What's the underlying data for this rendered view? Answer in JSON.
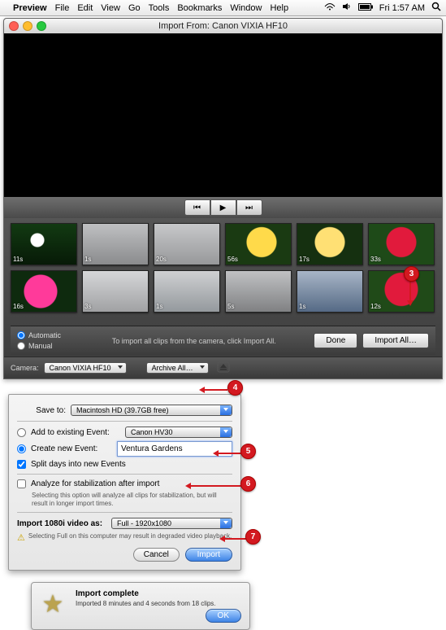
{
  "menu": {
    "items": [
      "Preview",
      "File",
      "Edit",
      "View",
      "Go",
      "Tools",
      "Bookmarks",
      "Window",
      "Help"
    ],
    "clock": "Fri 1:57 AM"
  },
  "window": {
    "title": "Import From: Canon VIXIA HF10"
  },
  "thumbs": [
    {
      "dur": "11s"
    },
    {
      "dur": "1s"
    },
    {
      "dur": "20s"
    },
    {
      "dur": "56s"
    },
    {
      "dur": "17s"
    },
    {
      "dur": "33s"
    },
    {
      "dur": "16s"
    },
    {
      "dur": "3s"
    },
    {
      "dur": "1s"
    },
    {
      "dur": "5s"
    },
    {
      "dur": "1s"
    },
    {
      "dur": "12s"
    }
  ],
  "bottom": {
    "auto_label": "Automatic",
    "manual_label": "Manual",
    "hint": "To import all clips from the camera, click Import All.",
    "done": "Done",
    "import_all": "Import All…"
  },
  "camfooter": {
    "label": "Camera:",
    "camera": "Canon VIXIA HF10",
    "archive": "Archive All…"
  },
  "sheet": {
    "save_to_label": "Save to:",
    "save_to_value": "Macintosh HD (39.7GB free)",
    "add_existing_label": "Add to existing Event:",
    "add_existing_value": "Canon HV30",
    "create_new_label": "Create new Event:",
    "create_new_value": "Ventura Gardens",
    "split_days": "Split days into new Events",
    "analyze": "Analyze for stabilization after import",
    "analyze_hint": "Selecting this option will analyze all clips for stabilization, but will result in longer import times.",
    "import1080_label": "Import 1080i video as:",
    "import1080_value": "Full - 1920x1080",
    "full_warn": "Selecting Full on this computer may result in degraded video playback.",
    "cancel": "Cancel",
    "import": "Import"
  },
  "complete": {
    "title": "Import complete",
    "detail": "Imported 8 minutes and 4 seconds from 18 clips.",
    "ok": "OK"
  },
  "callout_nums": {
    "n3": "3",
    "n4": "4",
    "n5": "5",
    "n6": "6",
    "n7": "7"
  }
}
